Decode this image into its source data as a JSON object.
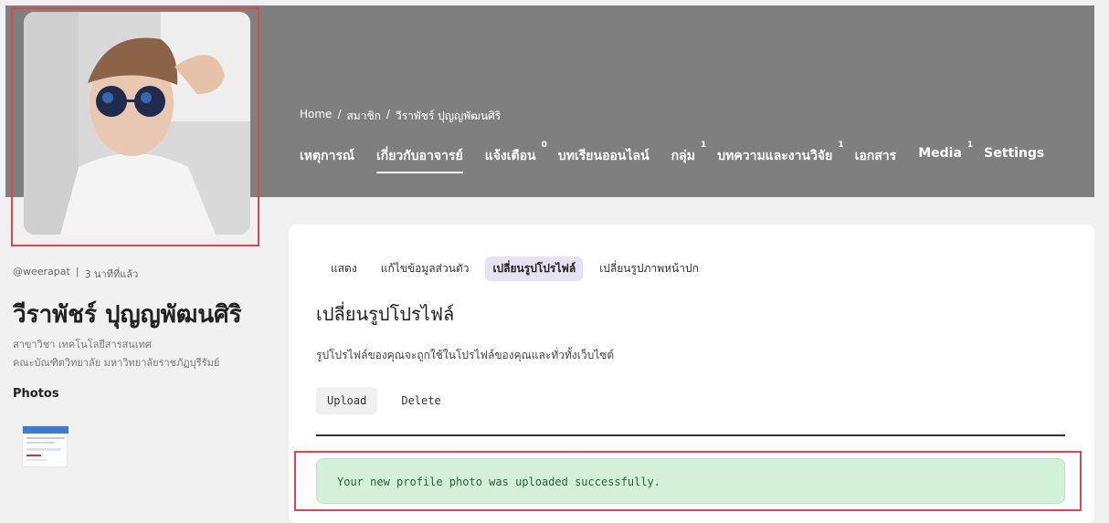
{
  "breadcrumb": {
    "home": "Home",
    "sep": "/",
    "members": "สมาชิก",
    "member_name": "วีราพัชร์ ปุญญพัฒนศิริ"
  },
  "nav": {
    "items": [
      {
        "label": "เหตุการณ์",
        "count": ""
      },
      {
        "label": "เกี่ยวกับอาจารย์",
        "count": ""
      },
      {
        "label": "แจ้งเตือน",
        "count": "0"
      },
      {
        "label": "บทเรียนออนไลน์",
        "count": ""
      },
      {
        "label": "กลุ่ม",
        "count": "1"
      },
      {
        "label": "บทความและงานวิจัย",
        "count": "1"
      },
      {
        "label": "เอกสาร",
        "count": ""
      },
      {
        "label": "Media",
        "count": "1"
      },
      {
        "label": "Settings",
        "count": ""
      }
    ],
    "active": "เกี่ยวกับอาจารย์"
  },
  "profile": {
    "username": "@weerapat",
    "separator": "|",
    "last_active": "3 นาทีที่แล้ว",
    "name": "วีราพัชร์ ปุญญพัฒนศิริ",
    "department_line1": "สาขาวิชา เทคโนโลยีสารสนเทศ",
    "department_line2": "คณะบัณฑิตวิทยาลัย มหาวิทยาลัยราชภัฏบุรีรัมย์",
    "photos_title": "Photos"
  },
  "subtabs": {
    "show": "แสดง",
    "edit_profile": "แก้ไขข้อมูลส่วนตัว",
    "change_photo": "เปลี่ยนรูปโปรไฟล์",
    "change_cover": "เปลี่ยนรูปภาพหน้าปก"
  },
  "section": {
    "title": "เปลี่ยนรูปโปรไฟล์",
    "description": "รูปโปรไฟล์ของคุณจะถูกใช้ในโปรไฟล์ของคุณและทั่วทั้งเว็บไซต์",
    "upload_label": "Upload",
    "delete_label": "Delete"
  },
  "alert": {
    "message": "Your new profile photo was uploaded successfully."
  },
  "colors": {
    "cover": "#7f7f7f",
    "highlight": "#e0474c",
    "success_bg": "#d4f0d9",
    "active_tab_bg": "#e6e2f3"
  }
}
